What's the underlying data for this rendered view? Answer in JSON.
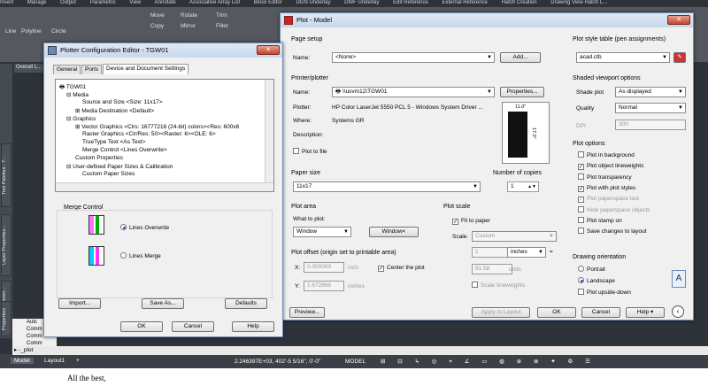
{
  "ribbon": {
    "tabs": [
      "Insert",
      "Manage",
      "Output",
      "Parametric",
      "View",
      "Annotate",
      "Associative Array List",
      "Block Editor",
      "DGN Underlay",
      "DWF Underlay",
      "Edit Reference",
      "External Reference",
      "Hatch Creation",
      "Drawing View Hatch L..."
    ],
    "tools": {
      "move": "Move",
      "rotate": "Rotate",
      "trim": "Trim",
      "copy": "Copy",
      "mirror": "Mirror",
      "fillet": "Fillet",
      "line": "Line",
      "polyline": "Polyline",
      "circle": "Circle"
    }
  },
  "left_tabs": [
    "Tool Palettes - T...",
    "Layer Properties...",
    "External Referen...",
    "Properties"
  ],
  "overall_tab": "Overall L...",
  "command_history": [
    "Autc",
    "Comm",
    "Comm",
    "Comm",
    "Comm"
  ],
  "command_line": "-_plot",
  "layout_tabs": {
    "model": "Model",
    "layout1": "Layout1",
    "add": "+"
  },
  "status": {
    "coords": "2.246397E+03, 402'-5 5/16\", 0'-0\"",
    "mode": "MODEL"
  },
  "below_text": "All the best,",
  "plotter_config": {
    "title": "Plotter Configuration Editor - TGW01",
    "tabs": [
      "General",
      "Ports",
      "Device and Document Settings"
    ],
    "tree": [
      "TGW01",
      "Media",
      "Source and Size <Size: 11x17>",
      "Media Destination <Default>",
      "Graphics",
      "Vector Graphics <Clrs: 16777216 (24-bit) colors><Res: 600x6",
      "Raster Graphics <Clr/Res: 50><Raster: 6><OLE: 6>",
      "TrueType Text <As Text>",
      "Merge Control <Lines Overwrite>",
      "Custom Properties",
      "User-defined Paper Sizes & Calibration",
      "Custom Paper Sizes"
    ],
    "merge_control": {
      "label": "Merge Control",
      "overwrite": "Lines Overwrite",
      "merge": "Lines Merge"
    },
    "buttons": {
      "import": "Import...",
      "save_as": "Save As...",
      "defaults": "Defaults",
      "ok": "OK",
      "cancel": "Cancel",
      "help": "Help"
    }
  },
  "plot": {
    "title": "Plot - Model",
    "page_setup": {
      "label": "Page setup",
      "name_label": "Name:",
      "name_value": "<None>",
      "add_button": "Add..."
    },
    "printer": {
      "label": "Printer/plotter",
      "name_label": "Name:",
      "name_value": "\\\\usvm12\\TGW01",
      "properties_button": "Properties...",
      "plotter_label": "Plotter:",
      "plotter_value": "HP Color LaserJet 5550 PCL 5 - Windows System Driver ...",
      "where_label": "Where:",
      "where_value": "Systems GR",
      "description_label": "Description:",
      "plot_to_file": "Plot to file",
      "preview_width": "11.0\"",
      "preview_height": "17.0\""
    },
    "paper_size": {
      "label": "Paper size",
      "value": "11x17"
    },
    "copies": {
      "label": "Number of copies",
      "value": "1"
    },
    "plot_area": {
      "label": "Plot area",
      "what_label": "What to plot:",
      "what_value": "Window",
      "window_button": "Window<"
    },
    "plot_offset": {
      "label": "Plot offset (origin set to printable area)",
      "x_label": "X:",
      "x_value": "0.000000",
      "x_unit": "inch",
      "y_label": "Y:",
      "y_value": "1.672866",
      "y_unit": "inches",
      "center": "Center the plot"
    },
    "plot_scale": {
      "label": "Plot scale",
      "fit": "Fit to paper",
      "scale_label": "Scale:",
      "scale_value": "Custom",
      "value1": "1",
      "units1": "inches",
      "equals": "=",
      "value2": "81.58",
      "units2": "units",
      "scale_lineweights": "Scale lineweights"
    },
    "style_table": {
      "label": "Plot style table (pen assignments)",
      "value": "acad.ctb"
    },
    "shaded": {
      "label": "Shaded viewport options",
      "shade_label": "Shade plot",
      "shade_value": "As displayed",
      "quality_label": "Quality",
      "quality_value": "Normal",
      "dpi_label": "DPI",
      "dpi_value": "300"
    },
    "plot_options": {
      "label": "Plot options",
      "items": [
        {
          "text": "Plot in background",
          "checked": false,
          "enabled": true
        },
        {
          "text": "Plot object lineweights",
          "checked": true,
          "enabled": true
        },
        {
          "text": "Plot transparency",
          "checked": false,
          "enabled": true
        },
        {
          "text": "Plot with plot styles",
          "checked": true,
          "enabled": true
        },
        {
          "text": "Plot paperspace last",
          "checked": true,
          "enabled": false
        },
        {
          "text": "Hide paperspace objects",
          "checked": false,
          "enabled": false
        },
        {
          "text": "Plot stamp on",
          "checked": false,
          "enabled": true
        },
        {
          "text": "Save changes to layout",
          "checked": false,
          "enabled": true
        }
      ]
    },
    "orientation": {
      "label": "Drawing orientation",
      "portrait": "Portrait",
      "landscape": "Landscape",
      "upside_down": "Plot upside-down"
    },
    "buttons": {
      "preview": "Preview...",
      "apply": "Apply to Layout",
      "ok": "OK",
      "cancel": "Cancel",
      "help": "Help"
    }
  }
}
